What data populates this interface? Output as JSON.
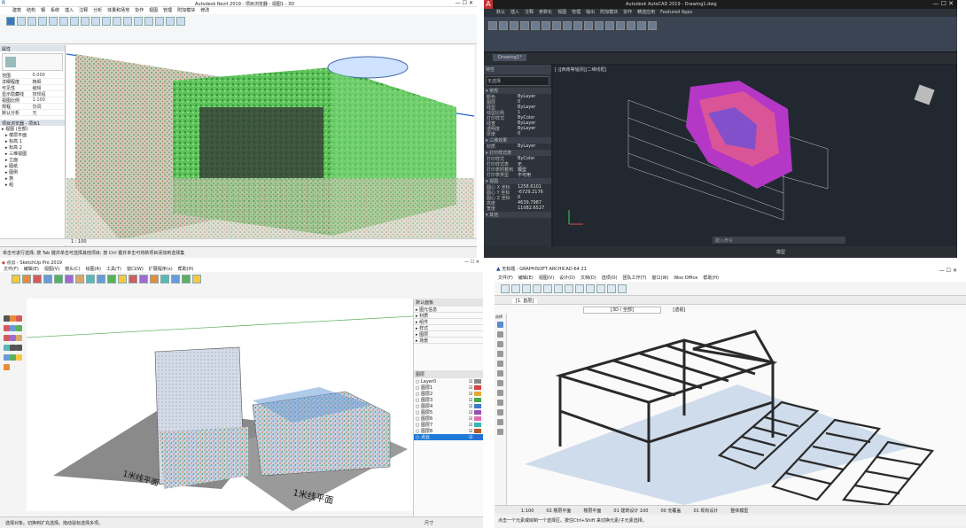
{
  "revit": {
    "title": "Autodesk Revit 2019 - 项目浏览器 - 视图1 - 3D",
    "tabs": [
      "建筑",
      "结构",
      "钢",
      "系统",
      "插入",
      "注释",
      "分析",
      "体量和场地",
      "协作",
      "视图",
      "管理",
      "附加模块",
      "修改"
    ],
    "properties_header": "属性",
    "properties_rows": [
      [
        "范围",
        "0.000"
      ],
      [
        "详细程度",
        "精细"
      ],
      [
        "可见性",
        "编辑"
      ],
      [
        "显示隐藏线",
        "按规程"
      ],
      [
        "视图比例",
        "1:100"
      ],
      [
        "规程",
        "协调"
      ],
      [
        "默认分析",
        "无"
      ]
    ],
    "browser_header": "项目浏览器 - 项目1",
    "browser_items": [
      "视图 (全部)",
      "楼层平面",
      "标高 1",
      "标高 2",
      "三维视图",
      "立面",
      "图纸",
      "图例",
      "族",
      "组"
    ],
    "status": "单击可进行选择; 按 Tab 键并单击可选择其他项目; 按 Ctrl 键并单击可将新项目添加到选择集",
    "scale": "1 : 100",
    "colors": {
      "panel": "#ffffff",
      "ribbon": "#f5f6f7",
      "accent": "#2b579a"
    }
  },
  "autocad": {
    "title": "Autodesk AutoCAD 2019 - Drawing1.dwg",
    "tabs": [
      "默认",
      "插入",
      "注释",
      "参数化",
      "视图",
      "管理",
      "输出",
      "附加模块",
      "协作",
      "精选应用",
      "Featured Apps"
    ],
    "file_tab": "Drawing1*",
    "viewport_label": "[-][西南等轴测][二维线框]",
    "props_header": "特性",
    "props_selector": "无选择",
    "props_sections": [
      {
        "name": "常规",
        "rows": [
          [
            "颜色",
            "ByLayer"
          ],
          [
            "图层",
            "0"
          ],
          [
            "线型",
            "ByLayer"
          ],
          [
            "线型比例",
            "1"
          ],
          [
            "打印样式",
            "ByColor"
          ],
          [
            "线宽",
            "ByLayer"
          ],
          [
            "透明度",
            "ByLayer"
          ],
          [
            "厚度",
            "0"
          ]
        ]
      },
      {
        "name": "三维效果",
        "rows": [
          [
            "材质",
            "ByLayer"
          ]
        ]
      },
      {
        "name": "打印样式表",
        "rows": [
          [
            "打印样式",
            "ByColor"
          ],
          [
            "打印样式表",
            "无"
          ],
          [
            "打印表附着到",
            "模型"
          ],
          [
            "打印表类型",
            "不可用"
          ]
        ]
      },
      {
        "name": "视图",
        "rows": [
          [
            "圆心 X 坐标",
            "1258.6101"
          ],
          [
            "圆心 Y 坐标",
            "-6729.2176"
          ],
          [
            "圆心 Z 坐标",
            "0"
          ],
          [
            "高度",
            "4639.7987"
          ],
          [
            "宽度",
            "11082.6527"
          ]
        ]
      },
      {
        "name": "其他",
        "rows": []
      }
    ],
    "cmd_placeholder": "键入命令",
    "model_tab": "模型",
    "colors": {
      "bg": "#1d232b",
      "panel": "#2d333b",
      "accent": "#c63232"
    }
  },
  "sketchup": {
    "title": "点云 - SketchUp Pro 2019",
    "menu": [
      "文件(F)",
      "编辑(E)",
      "视图(V)",
      "镜头(C)",
      "绘图(R)",
      "工具(T)",
      "窗口(W)",
      "扩展程序(x)",
      "帮助(H)"
    ],
    "tray_header": "默认面板",
    "tray_sections": [
      "图元信息",
      "材质",
      "组件",
      "样式",
      "图层",
      "场景"
    ],
    "layer_header": "图层",
    "layers": [
      "Layer0",
      "图层1",
      "图层2",
      "图层3",
      "图层4",
      "图层5",
      "图层6",
      "图层7",
      "图层8",
      "点云"
    ],
    "layer_colors": [
      "#888888",
      "#d6433f",
      "#e3a833",
      "#48a64b",
      "#3b79c9",
      "#9b4fb5",
      "#e06cb2",
      "#36b6b8",
      "#b35a2b",
      "#2a6ad3"
    ],
    "plane_label_1": "1米线平面",
    "plane_label_2": "1米线平面",
    "status": "选择对象。切换到扩充选择。拖动鼠标选择多项。",
    "measure_label": "尺寸",
    "colors": {
      "toolbar": "#f4f4f4",
      "select": "#1e7bd7"
    }
  },
  "archicad": {
    "title": "无标题 - GRAPHISOFT ARCHICAD-64 21",
    "menu": [
      "文件(F)",
      "编辑(E)",
      "视图(V)",
      "设计(D)",
      "文档(D)",
      "选项(O)",
      "团队工作(T)",
      "窗口(W)",
      "Woo Office",
      "帮助(H)"
    ],
    "view_tabs": [
      "[1. 首层]",
      "[3D / 全部]",
      "[透视]"
    ],
    "view_dropdown": "3D / 全部",
    "toolbox_header": "选择",
    "status": "点击一个元素或绘制一个选择区。按住Ctrl+Shift 来切换元素/子元素选择。",
    "bottom_fields": [
      "1:100",
      "02 楼层平面",
      "楼层平面",
      "01 建筑设计 100",
      "00 无覆盖",
      "01 现有设计",
      "整体模型"
    ],
    "colors": {
      "bg": "#f0f0f0",
      "ground": "#cfdceb",
      "frame": "#2a2a2a"
    }
  }
}
